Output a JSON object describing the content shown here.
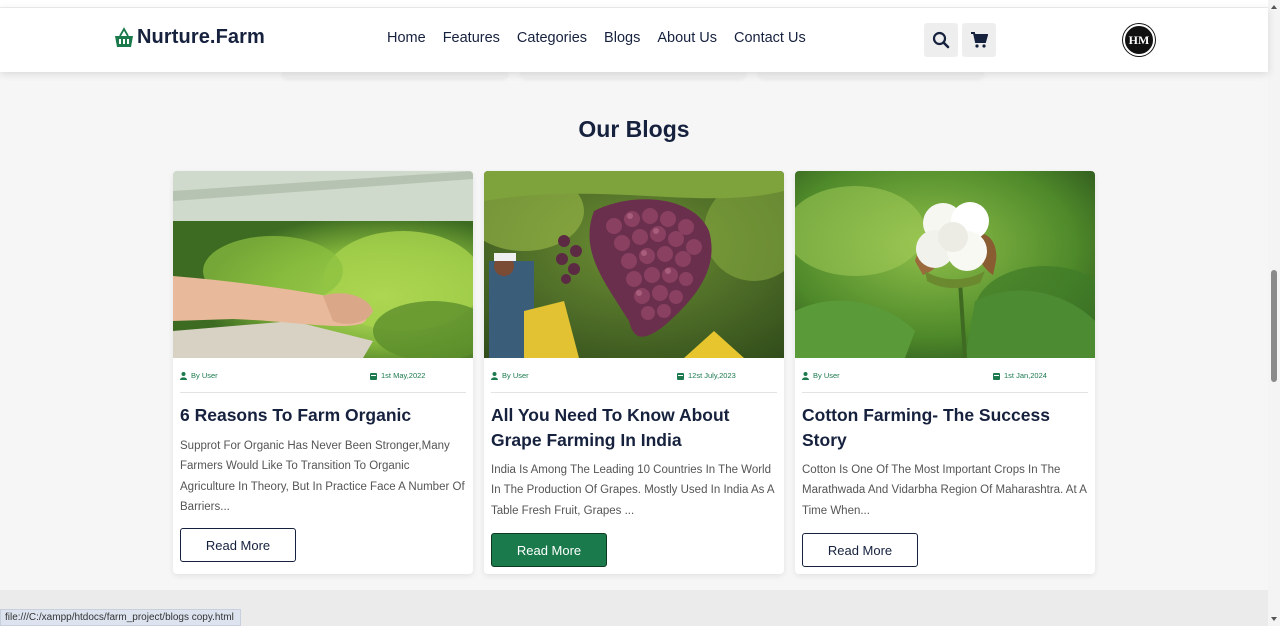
{
  "brand": {
    "name": "Nurture.Farm"
  },
  "nav": {
    "items": [
      {
        "label": "Home"
      },
      {
        "label": "Features"
      },
      {
        "label": "Categories"
      },
      {
        "label": "Blogs"
      },
      {
        "label": "About Us"
      },
      {
        "label": "Contact Us"
      }
    ]
  },
  "header_icons": {
    "search": "search-icon",
    "cart": "cart-icon",
    "avatar": "HM"
  },
  "section": {
    "title": "Our Blogs"
  },
  "blogs": [
    {
      "author": "By User",
      "date": "1st May,2022",
      "title": "6 Reasons To Farm Organic",
      "excerpt": "Supprot For Organic Has Never Been Stronger,Many Farmers Would Like To Transition To Organic Agriculture In Theory, But In Practice Face A Number Of Barriers...",
      "button": "Read More",
      "image": "greenhouse-lettuce"
    },
    {
      "author": "By User",
      "date": "12st July,2023",
      "title": "All You Need To Know About Grape Farming In India",
      "excerpt": "India Is Among The Leading 10 Countries In The World In The Production Of Grapes. Mostly Used In India As A Table Fresh Fruit, Grapes ...",
      "button": "Read More",
      "image": "grape-bunch"
    },
    {
      "author": "By User",
      "date": "1st Jan,2024",
      "title": "Cotton Farming- The Success Story",
      "excerpt": "Cotton Is One Of The Most Important Crops In The Marathwada And Vidarbha Region Of Maharashtra. At A Time When...",
      "button": "Read More",
      "image": "cotton-boll"
    }
  ],
  "status_bar": {
    "url": "file:///C:/xampp/htdocs/farm_project/blogs copy.html"
  },
  "colors": {
    "brand_green": "#1a7a4c",
    "navy": "#16213e",
    "meta_green": "#1c7a4e"
  }
}
